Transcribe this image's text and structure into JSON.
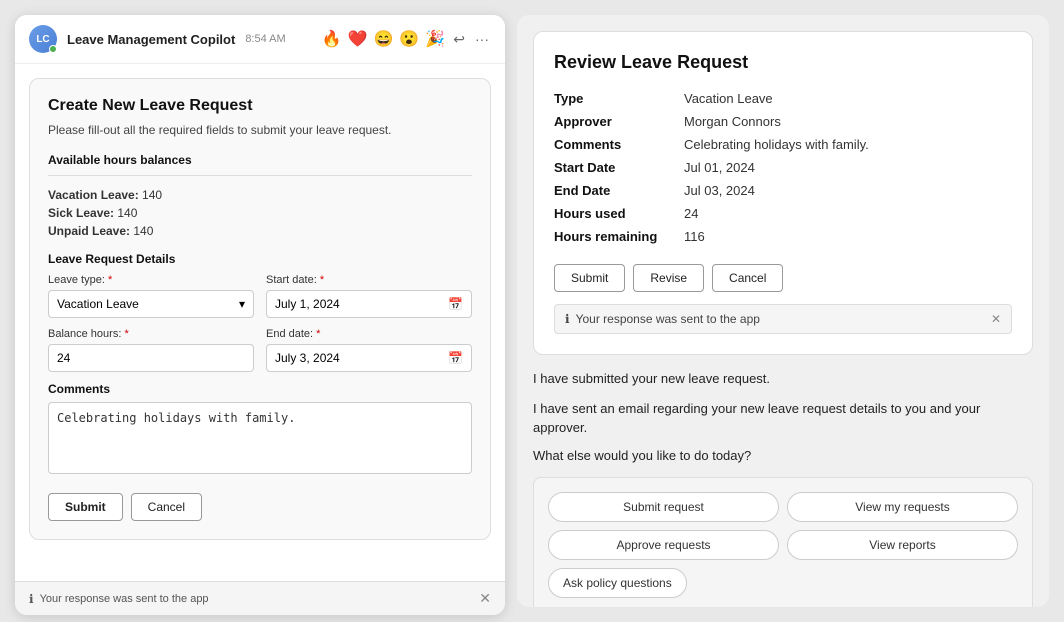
{
  "app": {
    "title": "Leave Management Copilot",
    "time": "8:54 AM"
  },
  "header_emojis": [
    "🔥",
    "❤️",
    "😄",
    "😮",
    "🎉"
  ],
  "form": {
    "title": "Create New Leave Request",
    "description": "Please fill-out all the required fields to submit your leave request.",
    "balances_title": "Available hours balances",
    "balances": [
      {
        "label": "Vacation Leave",
        "value": "140"
      },
      {
        "label": "Sick Leave",
        "value": "140"
      },
      {
        "label": "Unpaid Leave",
        "value": "140"
      }
    ],
    "details_title": "Leave Request Details",
    "leave_type_label": "Leave type:",
    "leave_type_value": "Vacation Leave",
    "start_date_label": "Start date:",
    "start_date_value": "July 1, 2024",
    "balance_hours_label": "Balance hours:",
    "balance_hours_value": "24",
    "end_date_label": "End date:",
    "end_date_value": "July 3, 2024",
    "comments_label": "Comments",
    "comments_value": "Celebrating holidays with family.",
    "submit_label": "Submit",
    "cancel_label": "Cancel"
  },
  "left_notification": "Your response was sent to the app",
  "review": {
    "title": "Review Leave Request",
    "fields": [
      {
        "label": "Type",
        "value": "Vacation Leave"
      },
      {
        "label": "Approver",
        "value": "Morgan Connors"
      },
      {
        "label": "Comments",
        "value": "Celebrating holidays with family."
      },
      {
        "label": "Start Date",
        "value": "Jul 01, 2024"
      },
      {
        "label": "End Date",
        "value": "Jul 03, 2024"
      },
      {
        "label": "Hours used",
        "value": "24"
      },
      {
        "label": "Hours remaining",
        "value": "116"
      }
    ],
    "submit_label": "Submit",
    "revise_label": "Revise",
    "cancel_label": "Cancel",
    "notification": "Your response was sent to the app"
  },
  "chat_messages": [
    "I have submitted your new leave request.",
    "I have sent an email regarding your new leave request details to you and your approver.",
    "What else would you like to do today?"
  ],
  "quick_replies": [
    {
      "label": "Submit request",
      "id": "submit-request"
    },
    {
      "label": "View my requests",
      "id": "view-my-requests"
    },
    {
      "label": "Approve requests",
      "id": "approve-requests"
    },
    {
      "label": "View reports",
      "id": "view-reports"
    },
    {
      "label": "Ask policy questions",
      "id": "ask-policy"
    }
  ]
}
